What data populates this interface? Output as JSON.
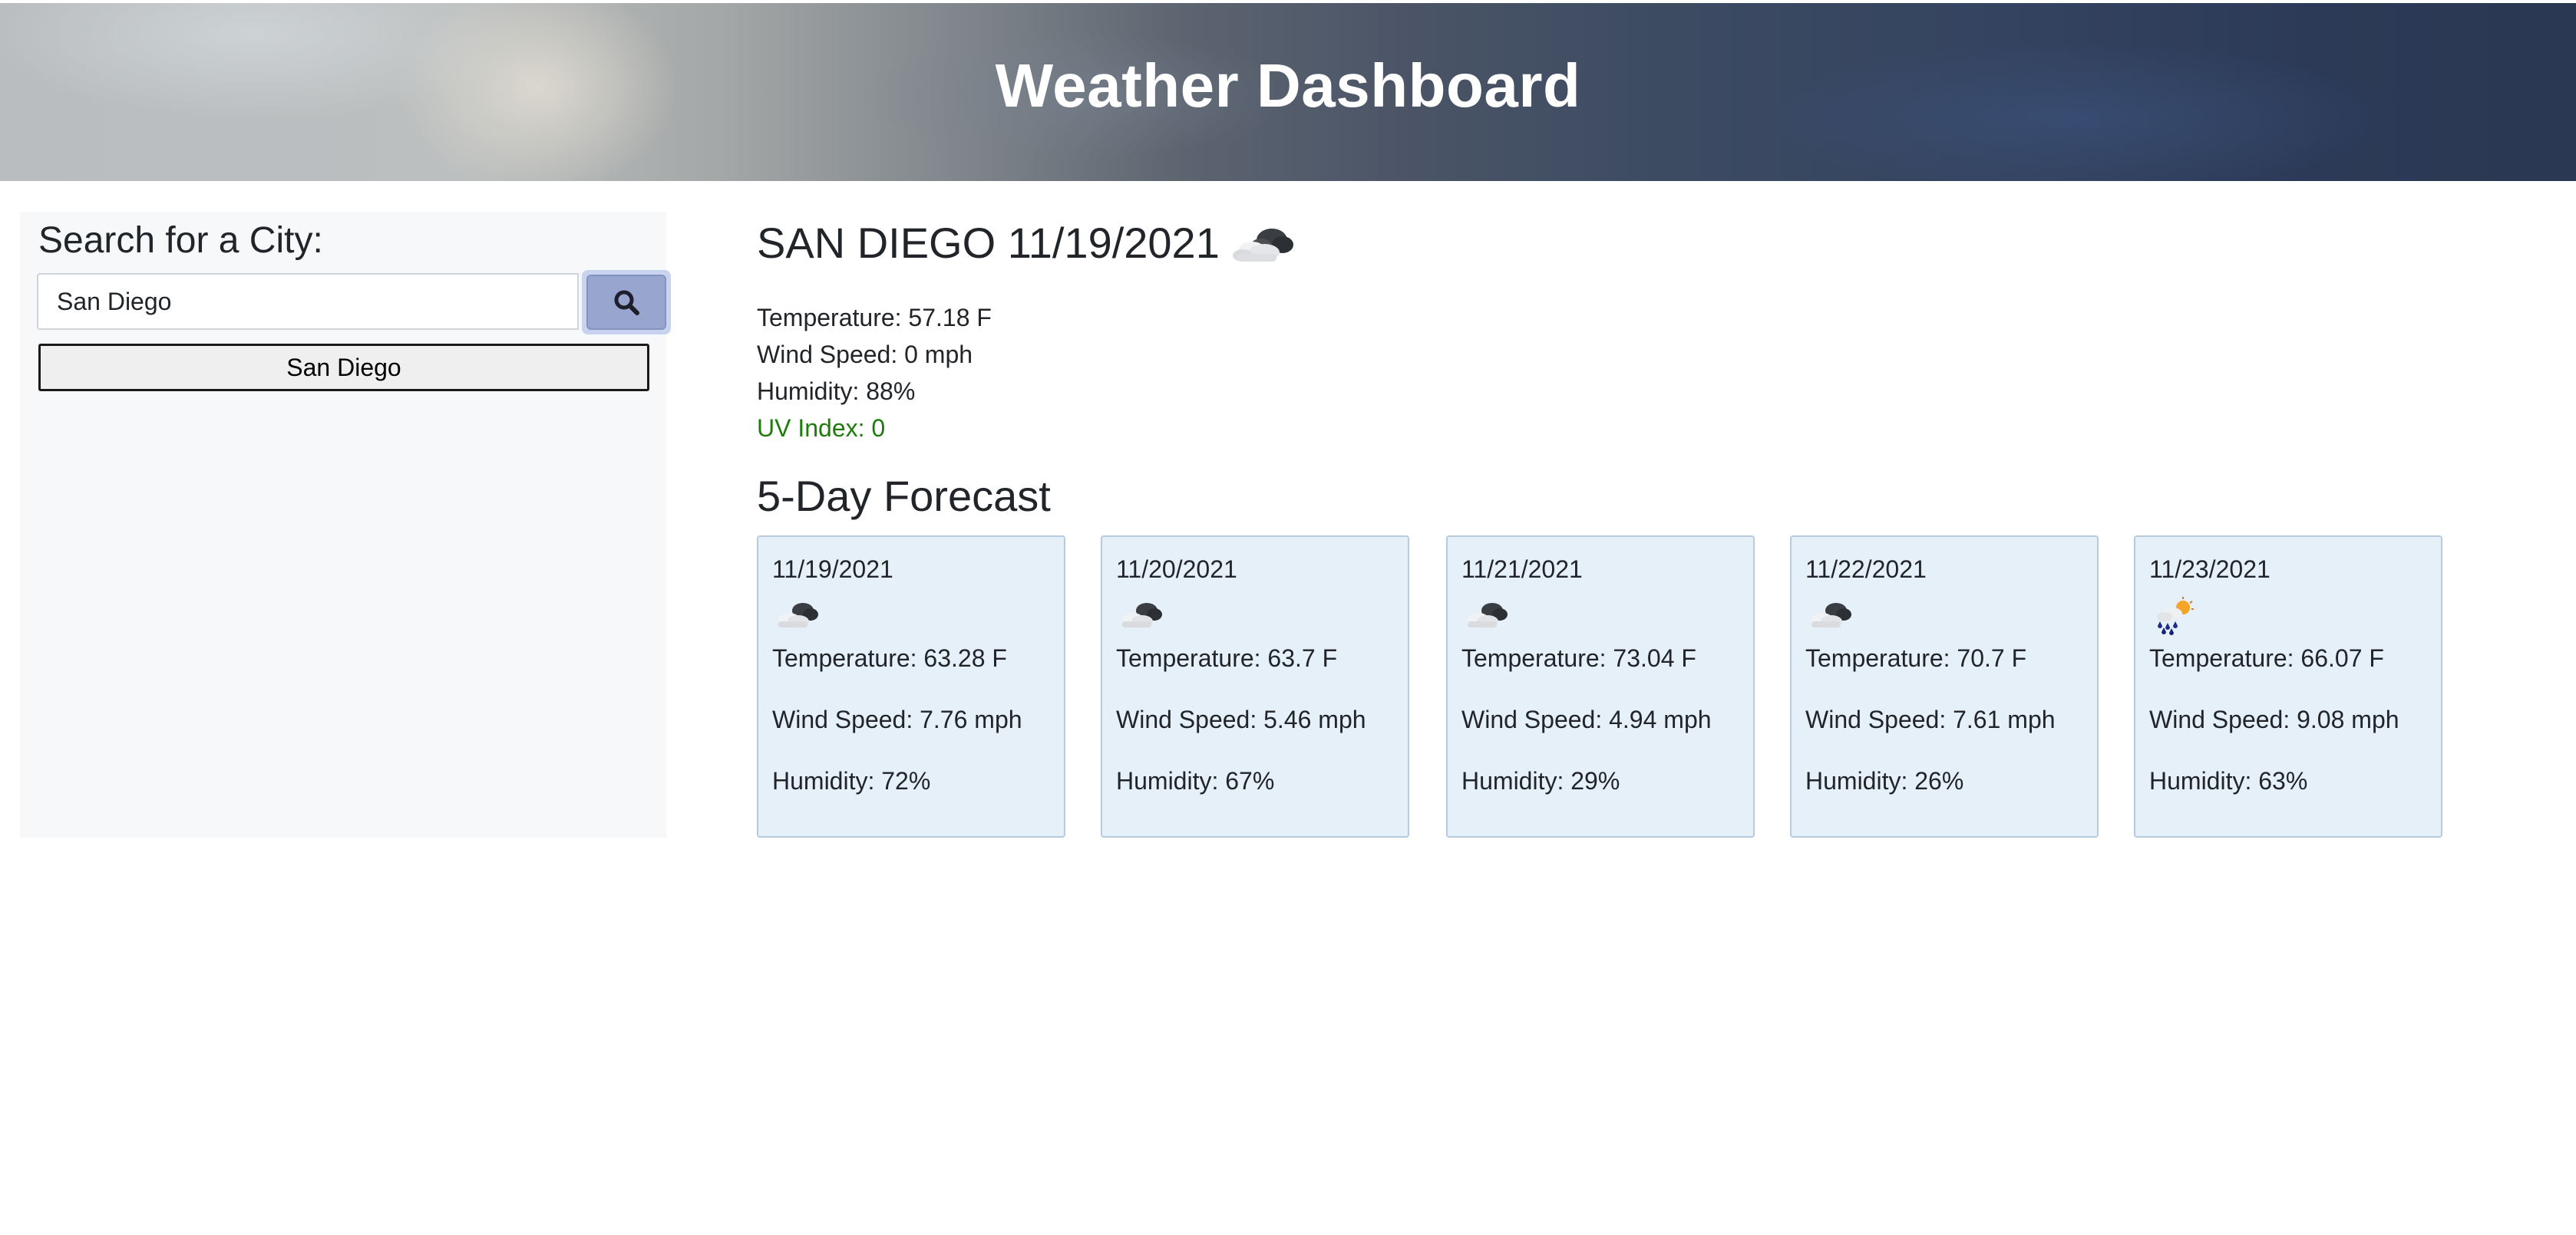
{
  "header": {
    "title": "Weather Dashboard"
  },
  "sidebar": {
    "title": "Search for a City:",
    "search_value": "San Diego",
    "search_button_icon": "search-icon",
    "history": [
      "San Diego"
    ]
  },
  "current": {
    "title": "SAN DIEGO 11/19/2021",
    "icon": "cloudy-icon",
    "temperature": "Temperature: 57.18 F",
    "wind": "Wind Speed: 0 mph",
    "humidity": "Humidity: 88%",
    "uv": "UV Index: 0",
    "uv_color": "#1e7b0c"
  },
  "forecast": {
    "title": "5-Day Forecast",
    "days": [
      {
        "date": "11/19/2021",
        "icon": "cloudy-icon",
        "temp": "Temperature: 63.28 F",
        "wind": "Wind Speed: 7.76 mph",
        "humidity": "Humidity: 72%"
      },
      {
        "date": "11/20/2021",
        "icon": "cloudy-icon",
        "temp": "Temperature: 63.7 F",
        "wind": "Wind Speed: 5.46 mph",
        "humidity": "Humidity: 67%"
      },
      {
        "date": "11/21/2021",
        "icon": "cloudy-icon",
        "temp": "Temperature: 73.04 F",
        "wind": "Wind Speed: 4.94 mph",
        "humidity": "Humidity: 29%"
      },
      {
        "date": "11/22/2021",
        "icon": "cloudy-icon",
        "temp": "Temperature: 70.7 F",
        "wind": "Wind Speed: 7.61 mph",
        "humidity": "Humidity: 26%"
      },
      {
        "date": "11/23/2021",
        "icon": "rain-sun-icon",
        "temp": "Temperature: 66.07 F",
        "wind": "Wind Speed: 9.08 mph",
        "humidity": "Humidity: 63%"
      }
    ]
  },
  "colors": {
    "card_background": "#e6f0f9",
    "card_border": "#b7cbe0",
    "search_button": "#97a5cf",
    "sidebar_background": "#f7f8fa"
  }
}
